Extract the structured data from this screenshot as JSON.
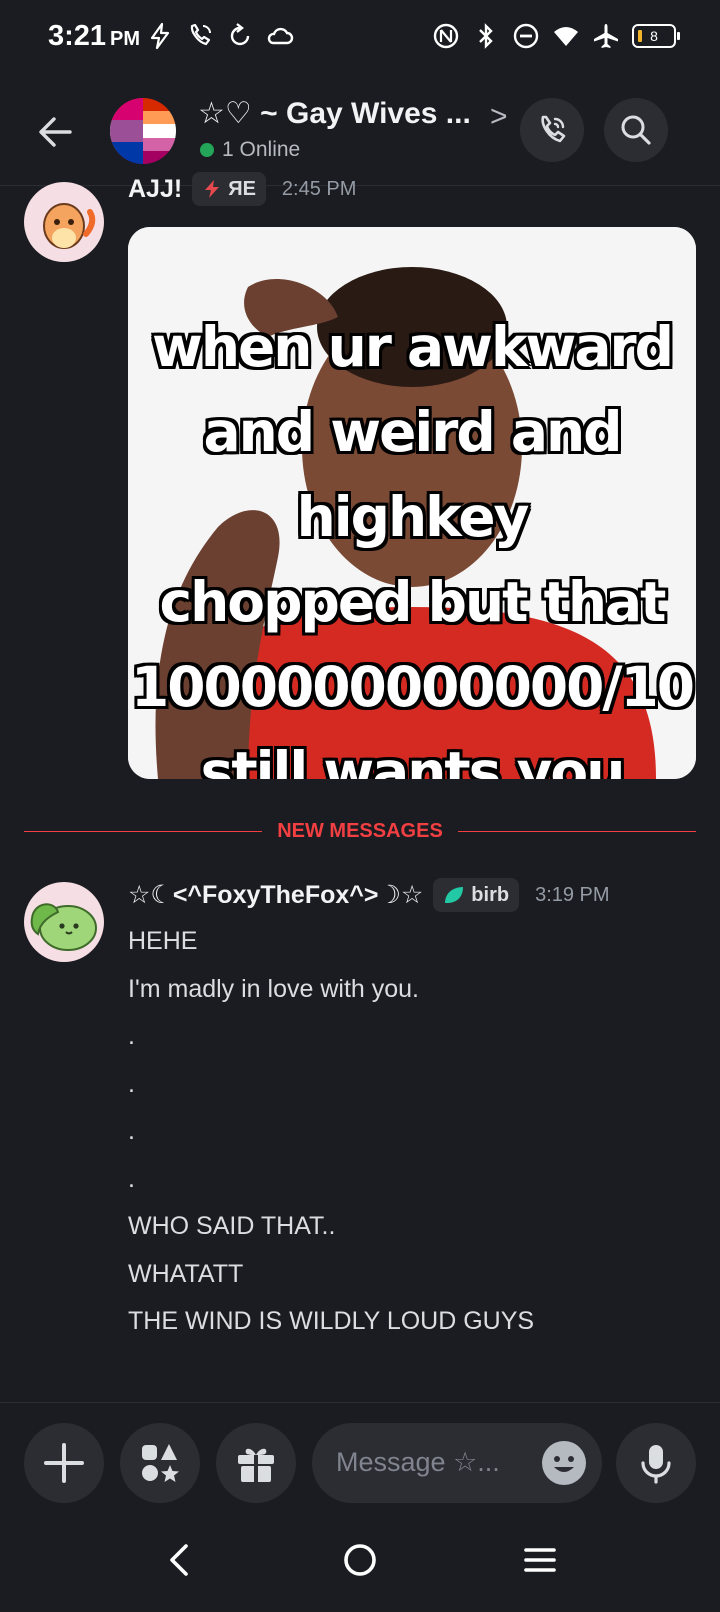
{
  "status": {
    "time": "3:21",
    "ampm": "PM",
    "battery": "8"
  },
  "header": {
    "title": "☆♡ ~ Gay Wives ...",
    "chevron": ">",
    "online": "1 Online"
  },
  "messages": [
    {
      "author": "AJJ!",
      "badge": "ЯE",
      "time": "2:45 PM",
      "meme_lines": [
        "when ur awkward",
        "and weird and highkey",
        "chopped but that",
        "1000000000000/10",
        "still wants you"
      ]
    },
    {
      "author": "☆☾<^FoxyTheFox^>☽☆",
      "badge": "birb",
      "time": "3:19 PM",
      "lines": [
        "HEHE",
        "I'm madly in love with you.",
        ".",
        ".",
        ".",
        ".",
        "WHO SAID THAT..",
        "WHATATT",
        "THE WIND IS WILDLY LOUD GUYS"
      ]
    }
  ],
  "divider": {
    "label": "NEW MESSAGES"
  },
  "composer": {
    "placeholder": "Message ☆..."
  },
  "colors": {
    "accent_red": "#f23f42",
    "online_green": "#23a55a",
    "bg": "#1b1c21"
  }
}
